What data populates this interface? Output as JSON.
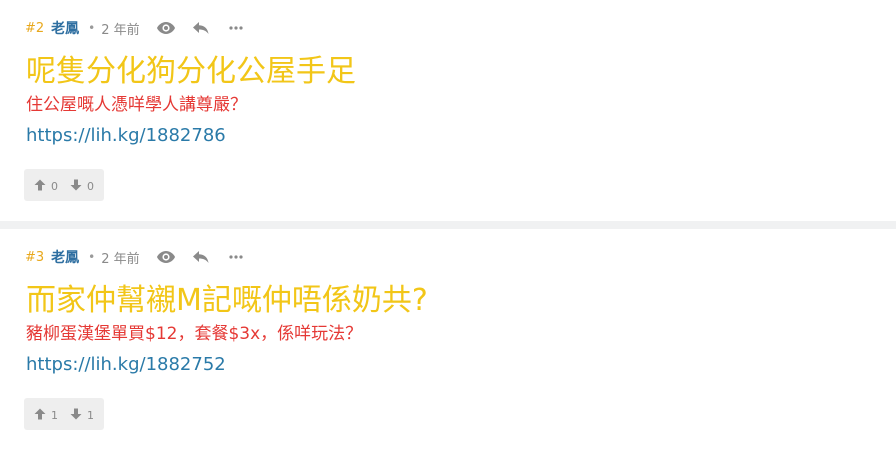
{
  "posts": [
    {
      "number": "#2",
      "author": "老鳳",
      "separator_dot": "•",
      "time": "2 年前",
      "title": "呢隻分化狗分化公屋手足",
      "subtitle": "住公屋嘅人憑咩學人講尊嚴？",
      "link": "https://lih.kg/1882786",
      "upvotes": "0",
      "downvotes": "0"
    },
    {
      "number": "#3",
      "author": "老鳳",
      "separator_dot": "•",
      "time": "2 年前",
      "title": "而家仲幫襯M記嘅仲唔係奶共?",
      "subtitle": "豬柳蛋漢堡單買$12，套餐$3x，係咩玩法？",
      "link": "https://lih.kg/1882752",
      "upvotes": "1",
      "downvotes": "1"
    }
  ],
  "icons": {
    "view": "eye-icon",
    "reply": "reply-icon",
    "more": "more-icon",
    "upvote": "thumbs-up-icon",
    "downvote": "thumbs-down-icon"
  },
  "colors": {
    "post_number": "#e8a81d",
    "author": "#2f6fa1",
    "title": "#f2c618",
    "subtitle": "#e53935",
    "link": "#2a7aa8",
    "vote_bg": "#eeeeee",
    "separator": "#f0f1f2"
  }
}
